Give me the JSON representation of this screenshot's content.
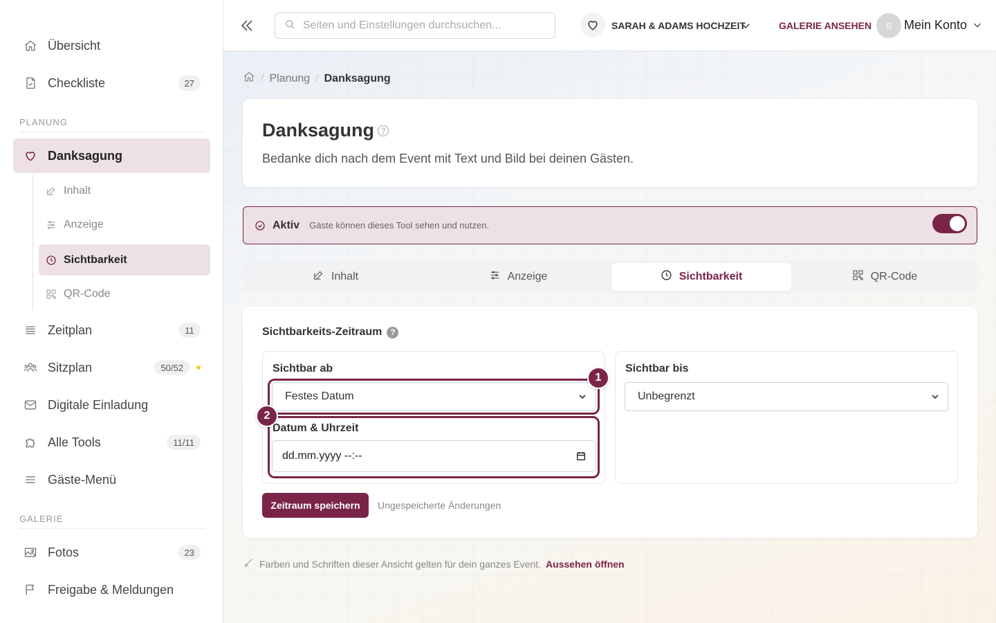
{
  "colors": {
    "accent": "#7a2448",
    "accent_soft": "#ede1e5",
    "badge_dot": "#f2d22e"
  },
  "sidebar": {
    "items_top": [
      {
        "label": "Übersicht",
        "icon": "home-icon"
      },
      {
        "label": "Checkliste",
        "icon": "checklist-icon",
        "badge": "27"
      }
    ],
    "section_planung": "PLANUNG",
    "active_item": {
      "label": "Danksagung",
      "icon": "heart-icon"
    },
    "sub_items": [
      {
        "label": "Inhalt",
        "icon": "edit-icon"
      },
      {
        "label": "Anzeige",
        "icon": "sliders-icon"
      },
      {
        "label": "Sichtbarkeit",
        "icon": "clock-icon"
      },
      {
        "label": "QR-Code",
        "icon": "qr-code-icon"
      }
    ],
    "items_mid": [
      {
        "label": "Zeitplan",
        "icon": "list-icon",
        "badge": "11"
      },
      {
        "label": "Sitzplan",
        "icon": "users-icon",
        "badge": "50/52"
      },
      {
        "label": "Digitale Einladung",
        "icon": "mail-icon"
      },
      {
        "label": "Alle Tools",
        "icon": "puzzle-icon",
        "badge": "11/11"
      },
      {
        "label": "Gäste-Menü",
        "icon": "menu-icon"
      }
    ],
    "section_galerie": "GALERIE",
    "items_bottom": [
      {
        "label": "Fotos",
        "icon": "image-icon",
        "badge": "23"
      },
      {
        "label": "Freigabe & Meldungen",
        "icon": "flag-icon"
      }
    ]
  },
  "topbar": {
    "search_placeholder": "Seiten und Einstellungen durchsuchen...",
    "event_name": "SARAH & ADAMS HOCHZEIT",
    "gallery_link": "GALERIE ANSEHEN",
    "avatar_initial": "S",
    "account_label": "Mein Konto"
  },
  "breadcrumb": {
    "parent": "Planung",
    "current": "Danksagung"
  },
  "header_card": {
    "title": "Danksagung",
    "description": "Bedanke dich nach dem Event mit Text und Bild bei deinen Gästen."
  },
  "status": {
    "label": "Aktiv",
    "hint": "Gäste können dieses Tool sehen und nutzen.",
    "enabled": true
  },
  "tabs": [
    {
      "label": "Inhalt",
      "icon": "edit-icon"
    },
    {
      "label": "Anzeige",
      "icon": "sliders-icon"
    },
    {
      "label": "Sichtbarkeit",
      "icon": "clock-icon",
      "active": true
    },
    {
      "label": "QR-Code",
      "icon": "qr-code-icon"
    }
  ],
  "visibility": {
    "section_title": "Sichtbarkeits-Zeitraum",
    "help_badge": "?",
    "from": {
      "title": "Sichtbar ab",
      "selected": "Festes Datum",
      "marker_1": "1",
      "marker_2": "2",
      "datetime_label": "Datum & Uhrzeit",
      "datetime_placeholder": "dd.mm.yyyy --:--"
    },
    "until": {
      "title": "Sichtbar bis",
      "selected": "Unbegrenzt"
    },
    "save_button": "Zeitraum speichern",
    "unsaved_note": "Ungespeicherte Änderungen"
  },
  "footer": {
    "note": "Farben und Schriften dieser Ansicht gelten für dein ganzes Event.",
    "link": "Aussehen öffnen"
  }
}
